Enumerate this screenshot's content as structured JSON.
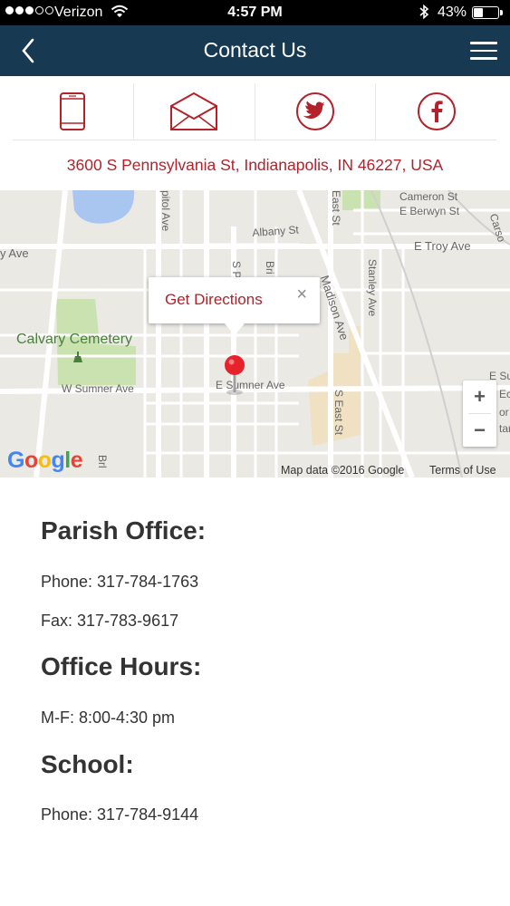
{
  "status_bar": {
    "carrier": "Verizon",
    "time": "4:57 PM",
    "battery_percent_text": "43%",
    "battery_level": 0.43,
    "signal_bars": 3
  },
  "header": {
    "title": "Contact Us"
  },
  "contact_icons": [
    "phone-icon",
    "mail-icon",
    "twitter-icon",
    "facebook-icon"
  ],
  "address": "3600 S Pennsylvania St, Indianapolis, IN 46227, USA",
  "map": {
    "labels": {
      "cameron": "Cameron St",
      "berwyn": "E Berwyn St",
      "albany": "Albany St",
      "troy": "E Troy Ave",
      "y_ave": "y Ave",
      "capitol": "pitol Ave",
      "east_st_top": "East St",
      "madison": "Madison Ave",
      "stanley": "Stanley Ave",
      "calvary": "Calvary Cemetery",
      "w_sumner": "W Sumner Ave",
      "e_sumner": "E Sumner Ave",
      "s_east_st": "S East St",
      "carson": "Carso",
      "brl": "Brl",
      "s_p": "S P",
      "bri": "Bri",
      "e_su": "E Su",
      "ec": "Ec",
      "or": "or",
      "tar": "tar"
    },
    "info_window": "Get Directions",
    "info_close": "×",
    "zoom_in": "+",
    "zoom_out": "−",
    "attribution": "Map data ©2016 Google",
    "terms": "Terms of Use",
    "colors": {
      "accent": "#b3222a",
      "header": "#173a52"
    }
  },
  "details": {
    "parish_heading": "Parish Office:",
    "parish_phone": "Phone: 317-784-1763",
    "parish_fax": "Fax: 317-783-9617",
    "hours_heading": "Office Hours:",
    "hours_text": "M-F: 8:00-4:30 pm",
    "school_heading": "School:",
    "school_phone": "Phone: 317-784-9144"
  }
}
